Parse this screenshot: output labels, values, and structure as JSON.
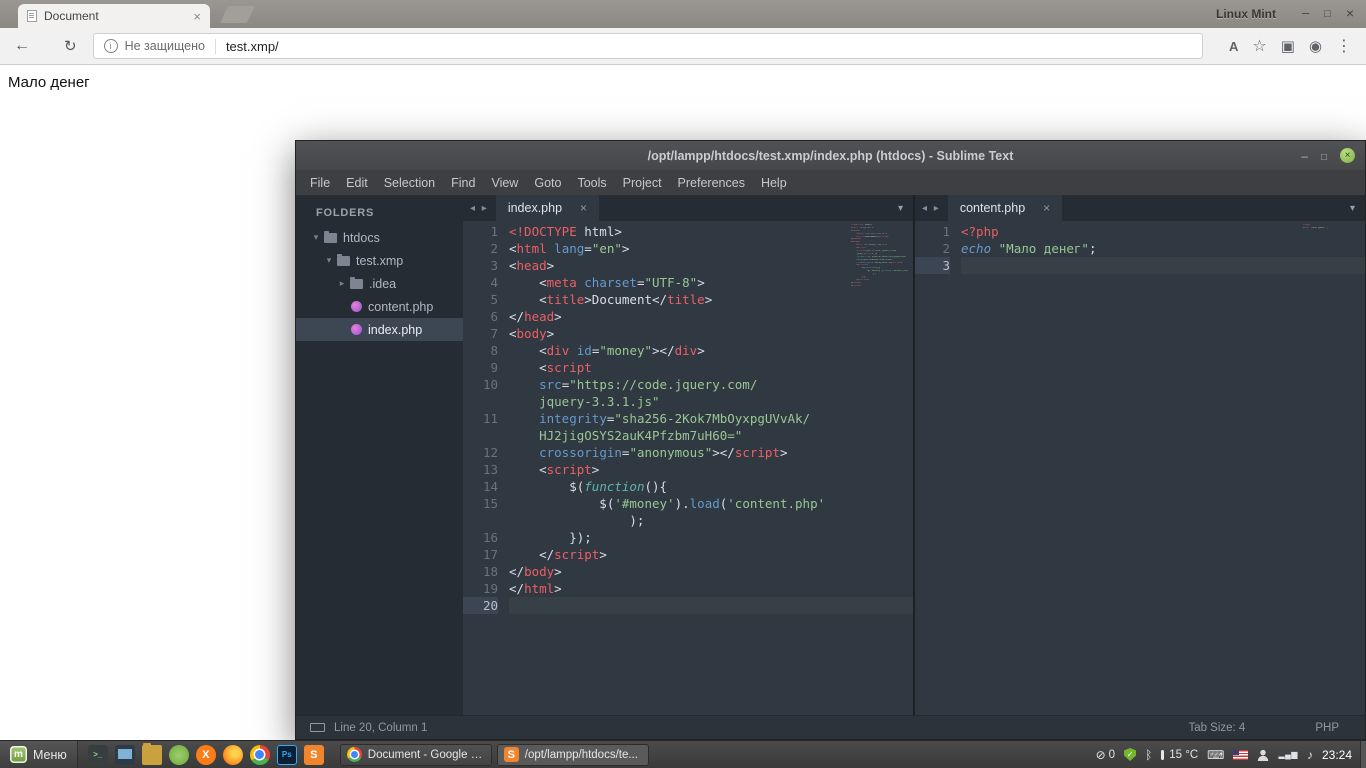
{
  "browser": {
    "tab": {
      "title": "Document"
    },
    "window_title": "Linux Mint",
    "address": {
      "security": "Не защищено",
      "url": "test.xmp/"
    },
    "page": {
      "text": "Мало денег"
    }
  },
  "sublime": {
    "title": "/opt/lampp/htdocs/test.xmp/index.php (htdocs) - Sublime Text",
    "menu": [
      "File",
      "Edit",
      "Selection",
      "Find",
      "View",
      "Goto",
      "Tools",
      "Project",
      "Preferences",
      "Help"
    ],
    "sidebar": {
      "heading": "FOLDERS",
      "items": [
        {
          "label": "htdocs",
          "kind": "folder",
          "state": "open",
          "indent": 0
        },
        {
          "label": "test.xmp",
          "kind": "folder",
          "state": "open",
          "indent": 1
        },
        {
          "label": ".idea",
          "kind": "folder",
          "state": "closed",
          "indent": 2
        },
        {
          "label": "content.php",
          "kind": "php",
          "indent": 2
        },
        {
          "label": "index.php",
          "kind": "php",
          "indent": 2,
          "selected": true
        }
      ]
    },
    "panes": [
      {
        "tab": "index.php",
        "minimap": true,
        "lines": [
          {
            "n": "1",
            "t": [
              [
                "r",
                "<!DOCTYPE"
              ],
              [
                "w",
                " html>"
              ]
            ]
          },
          {
            "n": "2",
            "t": [
              [
                "w",
                "<"
              ],
              [
                "r",
                "html"
              ],
              [
                "w",
                " "
              ],
              [
                "b",
                "lang"
              ],
              [
                "w",
                "="
              ],
              [
                "g",
                "\"en\""
              ],
              [
                "w",
                ">"
              ]
            ]
          },
          {
            "n": "3",
            "t": [
              [
                "w",
                "<"
              ],
              [
                "r",
                "head"
              ],
              [
                "w",
                ">"
              ]
            ]
          },
          {
            "n": "4",
            "t": [
              [
                "w",
                "    <"
              ],
              [
                "r",
                "meta"
              ],
              [
                "w",
                " "
              ],
              [
                "b",
                "charset"
              ],
              [
                "w",
                "="
              ],
              [
                "g",
                "\"UTF-8\""
              ],
              [
                "w",
                ">"
              ]
            ]
          },
          {
            "n": "5",
            "t": [
              [
                "w",
                "    <"
              ],
              [
                "r",
                "title"
              ],
              [
                "w",
                ">Document</"
              ],
              [
                "r",
                "title"
              ],
              [
                "w",
                ">"
              ]
            ]
          },
          {
            "n": "6",
            "t": [
              [
                "w",
                "</"
              ],
              [
                "r",
                "head"
              ],
              [
                "w",
                ">"
              ]
            ]
          },
          {
            "n": "7",
            "t": [
              [
                "w",
                "<"
              ],
              [
                "r",
                "body"
              ],
              [
                "w",
                ">"
              ]
            ]
          },
          {
            "n": "8",
            "t": [
              [
                "w",
                "    <"
              ],
              [
                "r",
                "div"
              ],
              [
                "w",
                " "
              ],
              [
                "b",
                "id"
              ],
              [
                "w",
                "="
              ],
              [
                "g",
                "\"money\""
              ],
              [
                "w",
                "></"
              ],
              [
                "r",
                "div"
              ],
              [
                "w",
                ">"
              ]
            ]
          },
          {
            "n": "9",
            "t": [
              [
                "w",
                "    <"
              ],
              [
                "r",
                "script"
              ]
            ]
          },
          {
            "n": "10",
            "t": [
              [
                "w",
                "    "
              ],
              [
                "b",
                "src"
              ],
              [
                "w",
                "="
              ],
              [
                "g",
                "\"https://code.jquery.com/"
              ]
            ]
          },
          {
            "n": "",
            "t": [
              [
                "g",
                "    jquery-3.3.1.js\""
              ]
            ]
          },
          {
            "n": "11",
            "t": [
              [
                "w",
                "    "
              ],
              [
                "b",
                "integrity"
              ],
              [
                "w",
                "="
              ],
              [
                "g",
                "\"sha256-2Kok7MbOyxpgUVvAk/"
              ]
            ]
          },
          {
            "n": "",
            "t": [
              [
                "g",
                "    HJ2jigOSYS2auK4Pfzbm7uH60=\""
              ]
            ]
          },
          {
            "n": "12",
            "t": [
              [
                "w",
                "    "
              ],
              [
                "b",
                "crossorigin"
              ],
              [
                "w",
                "="
              ],
              [
                "g",
                "\"anonymous\""
              ],
              [
                "w",
                "></"
              ],
              [
                "r",
                "script"
              ],
              [
                "w",
                ">"
              ]
            ]
          },
          {
            "n": "13",
            "t": [
              [
                "w",
                "    <"
              ],
              [
                "r",
                "script"
              ],
              [
                "w",
                ">"
              ]
            ]
          },
          {
            "n": "14",
            "t": [
              [
                "w",
                "        $("
              ],
              [
                "t",
                "function"
              ],
              [
                "w",
                "(){"
              ]
            ]
          },
          {
            "n": "15",
            "t": [
              [
                "w",
                "            $("
              ],
              [
                "g",
                "'#money'"
              ],
              [
                "w",
                ")."
              ],
              [
                "b",
                "load"
              ],
              [
                "w",
                "("
              ],
              [
                "g",
                "'content.php'"
              ]
            ]
          },
          {
            "n": "",
            "t": [
              [
                "w",
                "                );"
              ]
            ]
          },
          {
            "n": "16",
            "t": [
              [
                "w",
                "        });"
              ]
            ]
          },
          {
            "n": "17",
            "t": [
              [
                "w",
                "    </"
              ],
              [
                "r",
                "script"
              ],
              [
                "w",
                ">"
              ]
            ]
          },
          {
            "n": "18",
            "t": [
              [
                "w",
                "</"
              ],
              [
                "r",
                "body"
              ],
              [
                "w",
                ">"
              ]
            ]
          },
          {
            "n": "19",
            "t": [
              [
                "w",
                "</"
              ],
              [
                "r",
                "html"
              ],
              [
                "w",
                ">"
              ]
            ]
          },
          {
            "n": "20",
            "current": true,
            "t": []
          }
        ]
      },
      {
        "tab": "content.php",
        "minimap": true,
        "lines": [
          {
            "n": "1",
            "t": [
              [
                "r",
                "<?php"
              ]
            ]
          },
          {
            "n": "2",
            "t": [
              [
                "bi",
                "echo"
              ],
              [
                "w",
                " "
              ],
              [
                "g",
                "\"Мало денег\""
              ],
              [
                "w",
                ";"
              ]
            ]
          },
          {
            "n": "3",
            "current": true,
            "t": []
          }
        ]
      }
    ],
    "status": {
      "position": "Line 20, Column 1",
      "tab_size": "Tab Size: 4",
      "syntax": "PHP"
    }
  },
  "taskbar": {
    "menu_label": "Меню",
    "launchers": [
      {
        "name": "terminal"
      },
      {
        "name": "monitor"
      },
      {
        "name": "files"
      },
      {
        "name": "software-manager"
      },
      {
        "name": "xampp"
      },
      {
        "name": "firefox"
      },
      {
        "name": "chrome"
      },
      {
        "name": "photoshop"
      },
      {
        "name": "sublime"
      }
    ],
    "windows": [
      {
        "icon": "chrome",
        "label": "Document - Google C...",
        "active": false
      },
      {
        "icon": "sublime",
        "label": "/opt/lampp/htdocs/te...",
        "active": true
      }
    ],
    "tray": [
      {
        "name": "updates",
        "text": "0"
      },
      {
        "name": "shield"
      },
      {
        "name": "bluetooth"
      },
      {
        "name": "temperature",
        "text": "15 °C"
      },
      {
        "name": "keyboard"
      },
      {
        "name": "flag"
      },
      {
        "name": "user"
      },
      {
        "name": "network"
      },
      {
        "name": "volume"
      },
      {
        "name": "clock",
        "text": "23:24"
      }
    ]
  }
}
